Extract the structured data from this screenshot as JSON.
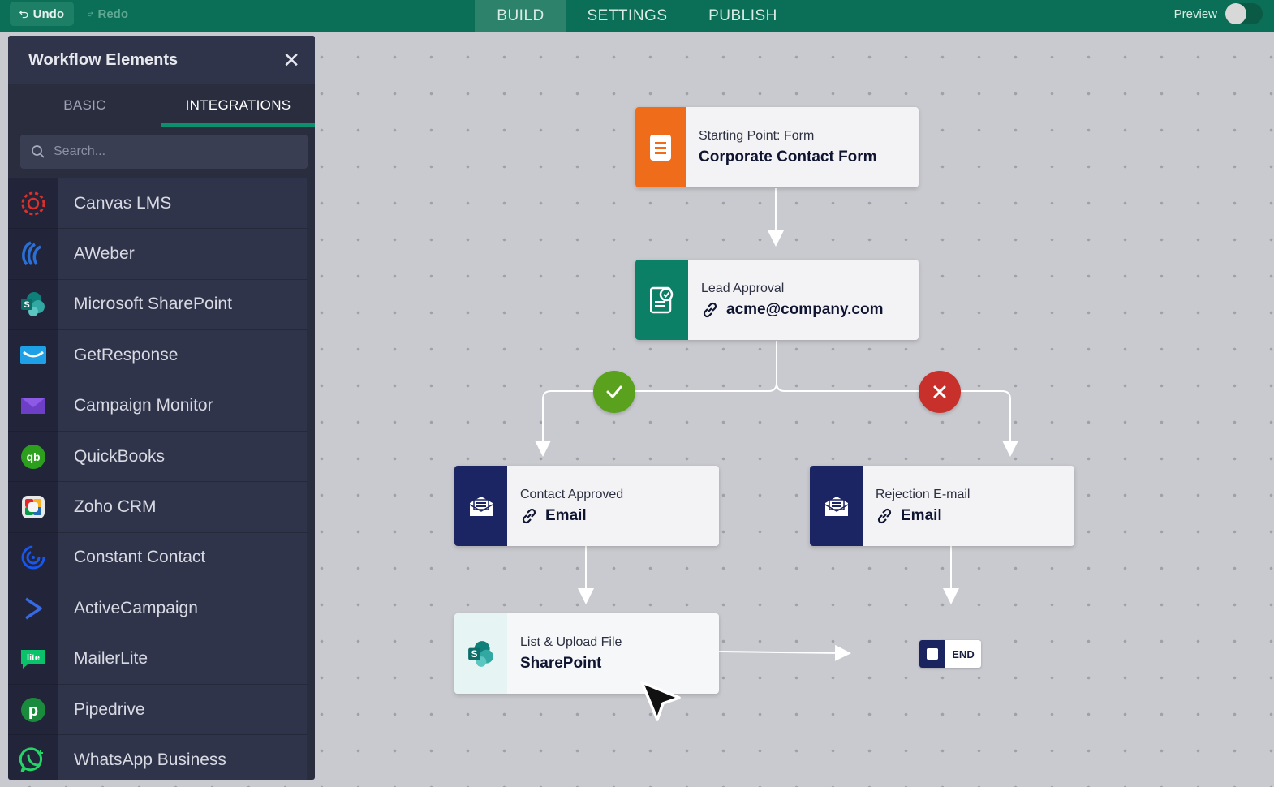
{
  "toolbar": {
    "undo": "Undo",
    "redo": "Redo",
    "tabs": [
      "BUILD",
      "SETTINGS",
      "PUBLISH"
    ],
    "active_tab": "BUILD",
    "preview": "Preview"
  },
  "sidebar": {
    "title": "Workflow Elements",
    "tabs": [
      "BASIC",
      "INTEGRATIONS"
    ],
    "active_tab": "INTEGRATIONS",
    "search_placeholder": "Search...",
    "items": [
      {
        "label": "Canvas LMS",
        "icon": "canvas-lms-icon"
      },
      {
        "label": "AWeber",
        "icon": "aweber-icon"
      },
      {
        "label": "Microsoft SharePoint",
        "icon": "sharepoint-icon"
      },
      {
        "label": "GetResponse",
        "icon": "getresponse-icon"
      },
      {
        "label": "Campaign Monitor",
        "icon": "campaign-monitor-icon"
      },
      {
        "label": "QuickBooks",
        "icon": "quickbooks-icon"
      },
      {
        "label": "Zoho CRM",
        "icon": "zoho-crm-icon"
      },
      {
        "label": "Constant Contact",
        "icon": "constant-contact-icon"
      },
      {
        "label": "ActiveCampaign",
        "icon": "activecampaign-icon"
      },
      {
        "label": "MailerLite",
        "icon": "mailerlite-icon"
      },
      {
        "label": "Pipedrive",
        "icon": "pipedrive-icon"
      },
      {
        "label": "WhatsApp Business",
        "icon": "whatsapp-icon"
      }
    ]
  },
  "flow": {
    "start": {
      "sub": "Starting Point: Form",
      "main": "Corporate Contact Form",
      "color": "#ef6c1a"
    },
    "approval": {
      "sub": "Lead Approval",
      "main": "acme@company.com",
      "color": "#0b8066"
    },
    "approved": {
      "sub": "Contact Approved",
      "main": "Email",
      "color": "#1c2563"
    },
    "rejected": {
      "sub": "Rejection E-mail",
      "main": "Email",
      "color": "#1c2563"
    },
    "sharepoint": {
      "sub": "List & Upload File",
      "main": "SharePoint"
    },
    "end": "END"
  },
  "colors": {
    "topbar": "#0b6e56",
    "approve_badge": "#5aa21d",
    "reject_badge": "#c8302c"
  }
}
